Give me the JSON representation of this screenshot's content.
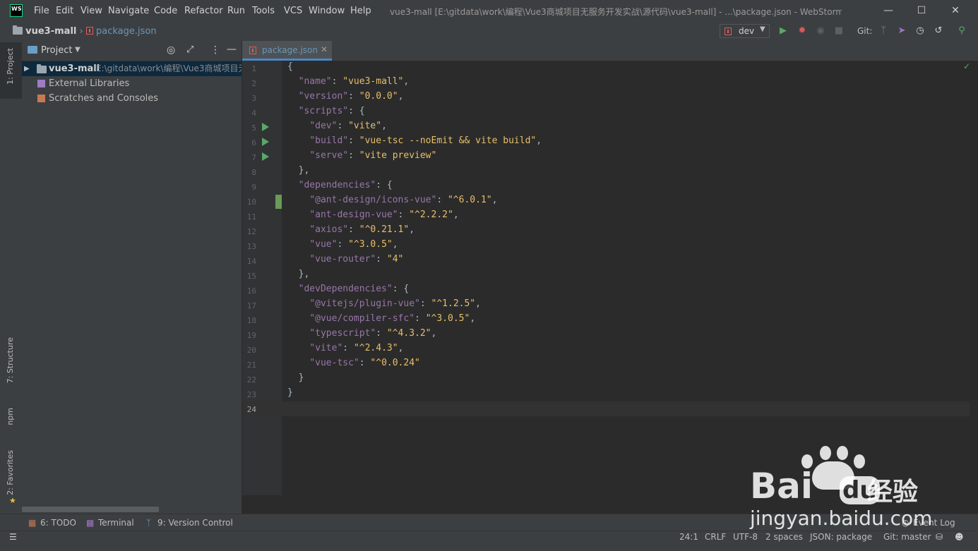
{
  "app": {
    "logo_text": "WS",
    "window_title": "vue3-mall [E:\\gitdata\\work\\编程\\Vue3商城项目无服务开发实战\\源代码\\vue3-mall] - ...\\package.json - WebStorm",
    "menu": [
      "File",
      "Edit",
      "View",
      "Navigate",
      "Code",
      "Refactor",
      "Run",
      "Tools",
      "VCS",
      "Window",
      "Help"
    ]
  },
  "navbar": {
    "project": "vue3-mall",
    "file": "package.json",
    "run_config": "dev",
    "git_label": "Git:"
  },
  "left_strip": {
    "project_tab": "1: Project",
    "structure_tab": "7: Structure",
    "npm_tab": "npm",
    "favorites_tab": "2: Favorites"
  },
  "project_panel": {
    "title": "Project",
    "root_name": "vue3-mall",
    "root_path": "E:\\gitdata\\work\\编程\\Vue3商城项目无",
    "external_libraries": "External Libraries",
    "scratches": "Scratches and Consoles"
  },
  "editor": {
    "tab_label": "package.json",
    "line_numbers": [
      "1",
      "2",
      "3",
      "4",
      "5",
      "6",
      "7",
      "8",
      "9",
      "10",
      "11",
      "12",
      "13",
      "14",
      "15",
      "16",
      "17",
      "18",
      "19",
      "20",
      "21",
      "22",
      "23",
      "24"
    ],
    "lines": [
      "{",
      "  \"name\": \"vue3-mall\",",
      "  \"version\": \"0.0.0\",",
      "  \"scripts\": {",
      "    \"dev\": \"vite\",",
      "    \"build\": \"vue-tsc --noEmit && vite build\",",
      "    \"serve\": \"vite preview\"",
      "  },",
      "  \"dependencies\": {",
      "    \"@ant-design/icons-vue\": \"^6.0.1\",",
      "    \"ant-design-vue\": \"^2.2.2\",",
      "    \"axios\": \"^0.21.1\",",
      "    \"vue\": \"^3.0.5\",",
      "    \"vue-router\": \"4\"",
      "  },",
      "  \"devDependencies\": {",
      "    \"@vitejs/plugin-vue\": \"^1.2.5\",",
      "    \"@vue/compiler-sfc\": \"^3.0.5\",",
      "    \"typescript\": \"^4.3.2\",",
      "    \"vite\": \"^2.4.3\",",
      "    \"vue-tsc\": \"^0.0.24\"",
      "  }",
      "}",
      ""
    ]
  },
  "bottom_tools": {
    "todo": "6: TODO",
    "terminal": "Terminal",
    "version_control": "9: Version Control",
    "event_log": "Event Log"
  },
  "status": {
    "position": "24:1",
    "line_sep": "CRLF",
    "encoding": "UTF-8",
    "indent": "2 spaces",
    "schema": "JSON: package",
    "git": "Git: master"
  },
  "watermark": {
    "brand": "Bai",
    "brand_du": "du",
    "jingyan": "经验",
    "url": "jingyan.baidu.com"
  }
}
